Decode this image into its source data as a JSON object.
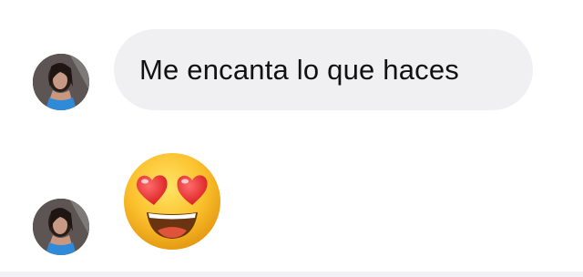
{
  "conversation": {
    "messages": [
      {
        "type": "text",
        "text": "Me encanta lo que haces",
        "sender_avatar": "avatar"
      },
      {
        "type": "emoji",
        "emoji": "smiling-face-with-heart-eyes",
        "sender_avatar": "avatar"
      }
    ]
  },
  "colors": {
    "bubble_background": "#f0f0f2",
    "message_text": "#111111",
    "background": "#ffffff"
  }
}
